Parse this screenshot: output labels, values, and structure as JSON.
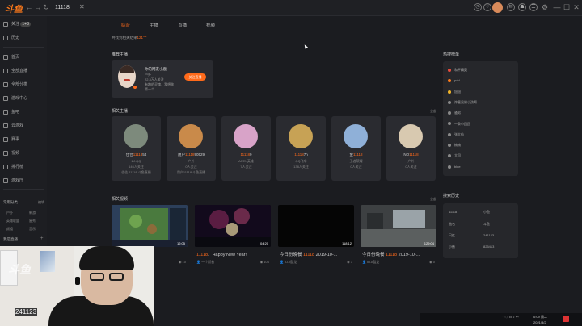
{
  "topbar": {
    "logo": "斗鱼",
    "search_value": "11118",
    "search_clear": "✕"
  },
  "sidebar": {
    "follow": "关注",
    "follow_badge": "1+3",
    "history": "历史",
    "nav": [
      {
        "label": "首页",
        "icon": "home-icon"
      },
      {
        "label": "全部直播",
        "icon": "live-icon"
      },
      {
        "label": "全部分类",
        "icon": "category-icon"
      },
      {
        "label": "游戏中心",
        "icon": "gamepad-icon"
      },
      {
        "label": "鱼吧",
        "icon": "fish-icon"
      },
      {
        "label": "云游戏",
        "icon": "cloud-icon"
      },
      {
        "label": "赛事",
        "icon": "trophy-icon"
      },
      {
        "label": "视频",
        "icon": "video-icon"
      },
      {
        "label": "排行榜",
        "icon": "rank-icon"
      },
      {
        "label": "游戏厅",
        "icon": "arcade-icon"
      }
    ],
    "common_tools": "常用分类",
    "edit": "编辑",
    "tools_grid": [
      "户外",
      "新游",
      "英雄联盟",
      "星秀",
      "颜值",
      "音乐"
    ],
    "anchor_tools": "我是直播",
    "add": "+"
  },
  "tabs": [
    {
      "label": "综合",
      "active": true
    },
    {
      "label": "主播",
      "active": false
    },
    {
      "label": "直播",
      "active": false
    },
    {
      "label": "视频",
      "active": false
    }
  ],
  "results": {
    "prefix": "共找到相关结果",
    "count": "121个"
  },
  "featured": {
    "section": "推荐主播",
    "name": "你的网友小鹿",
    "category": "户外",
    "fans": "22.3万人关注",
    "desc1": "有趣的灵魂，我想做",
    "desc2": "第一个",
    "button": "关注直播"
  },
  "anchors": {
    "section": "相关主播",
    "more": "全部",
    "items": [
      {
        "pre": "佳佳",
        "hl": "11118",
        "post": "54",
        "sub1": "ZJ.QQ",
        "sub2": "146人关注",
        "sub3": "佳佳 11118 斗鱼直播",
        "color": "#7d8a7c"
      },
      {
        "pre": "用户",
        "hl": "11118",
        "post": "90529",
        "sub1": "户外",
        "sub2": "0人关注",
        "sub3": "用户11118 斗鱼直播",
        "color": "#c98a4a"
      },
      {
        "pre": "",
        "hl": "11118",
        "post": "9",
        "sub1": "APEX英雄",
        "sub2": "7人关注",
        "sub3": "",
        "color": "#d8a3c8"
      },
      {
        "pre": "",
        "hl": "11118",
        "post": "7h",
        "sub1": "QQ飞车",
        "sub2": "138人关注",
        "sub3": "",
        "color": "#c7a255"
      },
      {
        "pre": "金",
        "hl": "11118",
        "post": "",
        "sub1": "王者荣耀",
        "sub2": "0人关注",
        "sub3": "",
        "color": "#8fb0d8"
      },
      {
        "pre": "NO",
        "hl": "11118",
        "post": "",
        "sub1": "户外",
        "sub2": "0人关注",
        "sub3": "",
        "color": "#d8c9b0"
      }
    ]
  },
  "videos": {
    "section": "相关视频",
    "more": "全部",
    "items": [
      {
        "title_pre": "",
        "hl": "",
        "title_post": "",
        "duration": "12:05",
        "author": "",
        "count": "10"
      },
      {
        "title_pre": "",
        "hl": "11118",
        "title_post": "、Happy New Year!",
        "duration": "04:20",
        "author": "一个斯普",
        "count": "106"
      },
      {
        "title_pre": "今日份晚餐 ",
        "hl": "11118",
        "title_post": " 2019-10-...",
        "duration": "118:12",
        "author": "ID-li酷龙",
        "count": "3"
      },
      {
        "title_pre": "今日份晚餐 ",
        "hl": "11118",
        "title_post": " 2019-10-...",
        "duration": "129:04",
        "author": "ID-li酷龙",
        "count": "0"
      }
    ]
  },
  "hot": {
    "section": "热搜榜单",
    "items": [
      {
        "label": "和平精英",
        "color": "#e74c3c"
      },
      {
        "label": "pdd",
        "color": "#ff7a1a"
      },
      {
        "label": "旭旭",
        "color": "#f0b429"
      },
      {
        "label": "神童吴谦小孩哥",
        "color": "#888888"
      },
      {
        "label": "骚男",
        "color": "#888888"
      },
      {
        "label": "一条小团团",
        "color": "#888888"
      },
      {
        "label": "张大仙",
        "color": "#888888"
      },
      {
        "label": "楠楠",
        "color": "#888888"
      },
      {
        "label": "大司",
        "color": "#888888"
      },
      {
        "label": "blue",
        "color": "#888888"
      }
    ]
  },
  "history": {
    "section": "搜索历史",
    "rows": [
      {
        "left": "11118",
        "right": "小鱼"
      },
      {
        "left": "曲名",
        "right": "斗鱼"
      },
      {
        "left": "只红",
        "right": "241123"
      },
      {
        "left": "小伟",
        "right": "825413"
      }
    ]
  },
  "tray": {
    "time": "0:09 周二",
    "date": "2021/3/2"
  },
  "cam": {
    "logo": "斗鱼",
    "room": "241123"
  }
}
